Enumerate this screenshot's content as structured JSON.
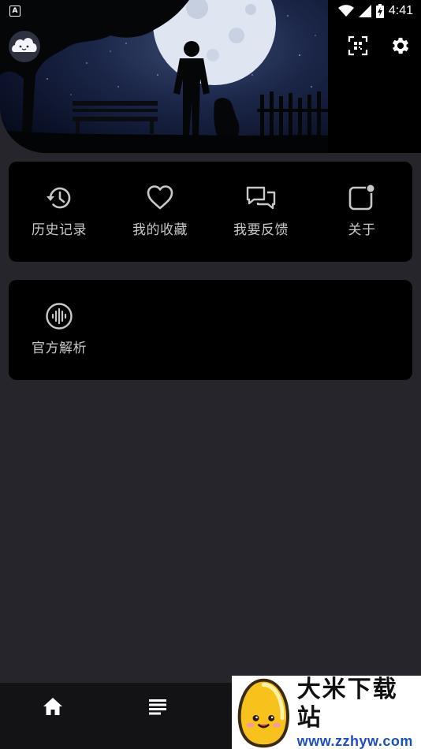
{
  "status_bar": {
    "app_indicator": "A",
    "time": "4:41",
    "battery_level_percent": 60,
    "icons": [
      "wifi-icon",
      "signal-icon",
      "battery-charging-icon"
    ]
  },
  "header": {
    "avatar_icon": "cloud-avatar-icon",
    "actions": [
      {
        "name": "scan-button",
        "icon": "qr-scan-icon"
      },
      {
        "name": "settings-button",
        "icon": "gear-icon"
      }
    ]
  },
  "menu_top": {
    "items": [
      {
        "label": "历史记录",
        "icon": "history-icon"
      },
      {
        "label": "我的收藏",
        "icon": "heart-icon"
      },
      {
        "label": "我要反馈",
        "icon": "chat-bubbles-icon"
      },
      {
        "label": "关于",
        "icon": "notification-square-icon"
      }
    ]
  },
  "menu_bottom": {
    "items": [
      {
        "label": "官方解析",
        "icon": "sound-wave-icon"
      }
    ]
  },
  "bottom_nav": {
    "items": [
      {
        "name": "nav-home",
        "icon": "home-icon"
      },
      {
        "name": "nav-list",
        "icon": "list-icon"
      }
    ]
  },
  "watermark": {
    "title": "大米下载站",
    "url": "www.zzhyw.com"
  },
  "colors": {
    "background": "#26252b",
    "card": "#000000",
    "label": "#c8c8c8",
    "nav_bg": "#131316",
    "watermark_url": "#1b4fbf"
  }
}
